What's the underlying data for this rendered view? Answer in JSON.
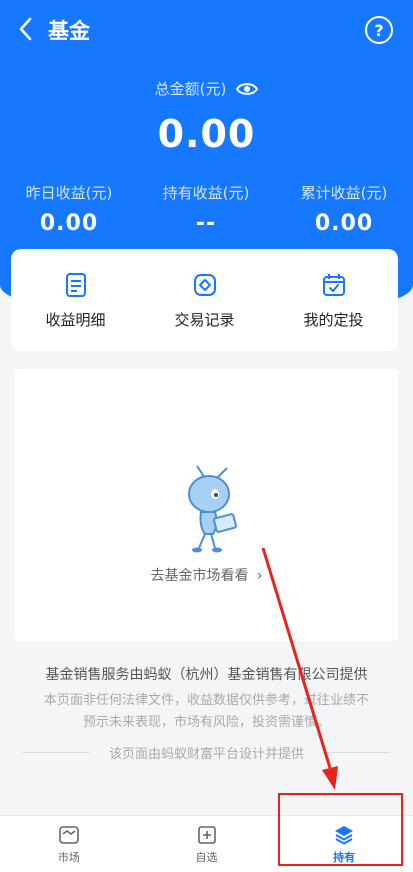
{
  "header": {
    "title": "基金",
    "back_icon": "back-chevron-icon",
    "help_symbol": "?",
    "background": "#1677ff"
  },
  "summary": {
    "total_label": "总金额(元)",
    "total_value": "0.00",
    "stats": [
      {
        "label": "昨日收益(元)",
        "value": "0.00"
      },
      {
        "label": "持有收益(元)",
        "value": "--"
      },
      {
        "label": "累计收益(元)",
        "value": "0.00"
      }
    ]
  },
  "quick_actions": [
    {
      "label": "收益明细",
      "icon": "document-icon"
    },
    {
      "label": "交易记录",
      "icon": "diamond-icon"
    },
    {
      "label": "我的定投",
      "icon": "calendar-check-icon"
    }
  ],
  "empty_state": {
    "link_text": "去基金市场看看",
    "chevron": "›"
  },
  "disclaimer": {
    "main": "基金销售服务由蚂蚁（杭州）基金销售有限公司提供",
    "line1": "本页面非任何法律文件，收益数据仅供参考，过往业绩不",
    "line2": "预示未来表现，市场有风险，投资需谨慎。",
    "platform": "该页面由蚂蚁财富平台设计并提供"
  },
  "tabbar": [
    {
      "label": "市场",
      "icon": "market-icon",
      "active": false
    },
    {
      "label": "自选",
      "icon": "add-square-icon",
      "active": false
    },
    {
      "label": "持有",
      "icon": "layers-icon",
      "active": true
    }
  ],
  "colors": {
    "accent": "#1677ff",
    "annotation": "#e8231e"
  }
}
